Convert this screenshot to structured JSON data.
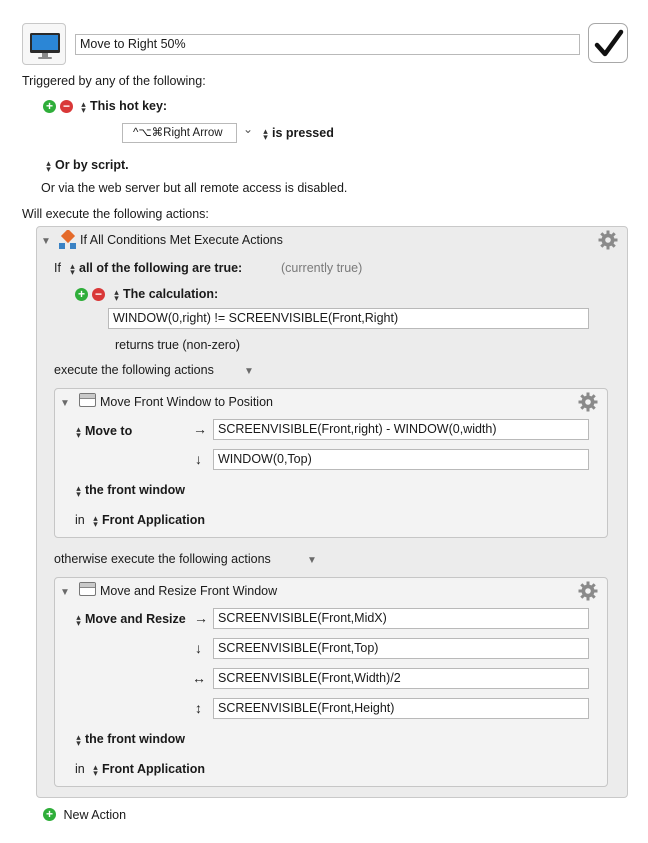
{
  "macro": {
    "name": "Move to Right 50%"
  },
  "triggers": {
    "heading": "Triggered by any of the following:",
    "hotkey_label": "This hot key:",
    "hotkey_value": "^⌥⌘Right Arrow",
    "hotkey_state": "is pressed",
    "script_label": "Or by script.",
    "web_server_note": "Or via the web server but all remote access is disabled."
  },
  "actions_heading": "Will execute the following actions:",
  "if_action": {
    "title": "If All Conditions Met Execute Actions",
    "if_word": "If",
    "match_mode": "all of the following are true:",
    "status": "(currently true)",
    "condition_label": "The calculation:",
    "calculation": "WINDOW(0,right) != SCREENVISIBLE(Front,Right)",
    "calc_result": "returns true (non-zero)",
    "then_label": "execute the following actions",
    "else_label": "otherwise execute the following actions"
  },
  "move_action": {
    "title": "Move Front Window to Position",
    "mode": "Move to",
    "x_expr": "SCREENVISIBLE(Front,right) - WINDOW(0,width)",
    "y_expr": "WINDOW(0,Top)",
    "target": "the front window",
    "in_word": "in",
    "app": "Front Application"
  },
  "resize_action": {
    "title": "Move and Resize Front Window",
    "mode": "Move and Resize",
    "x_expr": "SCREENVISIBLE(Front,MidX)",
    "y_expr": "SCREENVISIBLE(Front,Top)",
    "w_expr": "SCREENVISIBLE(Front,Width)/2",
    "h_expr": "SCREENVISIBLE(Front,Height)",
    "target": "the front window",
    "in_word": "in",
    "app": "Front Application"
  },
  "new_action_label": "New Action",
  "glyphs": {
    "right_arrow": "→",
    "down_arrow": "↓",
    "horizontal_arrow": "↔",
    "vertical_arrow": "↕",
    "disclosure": "▼",
    "menu_chevron": "⌄"
  },
  "colors": {
    "add_green": "#2fae3a",
    "remove_red": "#d93838",
    "panel_bg": "#ececec",
    "inner_bg": "#f3f3f3"
  }
}
